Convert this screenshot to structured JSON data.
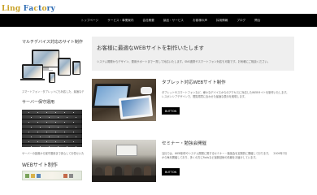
{
  "logo": {
    "chars": [
      {
        "ch": "L",
        "color": "#c9a227"
      },
      {
        "ch": "i",
        "color": "#c9a227"
      },
      {
        "ch": "n",
        "color": "#c9a227"
      },
      {
        "ch": "g",
        "color": "#c9a227"
      },
      {
        "ch": " ",
        "color": "#ffffff"
      },
      {
        "ch": "F",
        "color": "#2d6bb3"
      },
      {
        "ch": "a",
        "color": "#2d6bb3"
      },
      {
        "ch": "c",
        "color": "#c9a227"
      },
      {
        "ch": "t",
        "color": "#2d6bb3"
      },
      {
        "ch": "o",
        "color": "#c9a227"
      },
      {
        "ch": "r",
        "color": "#2d6bb3"
      },
      {
        "ch": "y",
        "color": "#2d6bb3"
      }
    ]
  },
  "nav": {
    "items": [
      "トップページ",
      "サービス・事業案内",
      "会社概要",
      "製品・サービス",
      "お客様の声",
      "採用情報",
      "ブログ",
      "問合"
    ]
  },
  "sidebar": {
    "section1_title": "マルチデバイス対応のサイト制作",
    "section1_text": "スマートフォン・タブレットにも対応した、最適なデザインです",
    "section2_title": "サーバー保守運用",
    "section2_text": "サーバーの設置から保守運用まで安心してお任せいただけます",
    "section3_title": "WEBサイト制作"
  },
  "hero": {
    "title": "お客様に最適なWEBサイトを制作いたします",
    "text": "システム開発からデザイン、運用サポートまで一貫して対応いたします。SNS連携やスマートフォン対応も可能です。お気軽にご相談ください。"
  },
  "articles": [
    {
      "title": "タブレット対応WEBサイト制作",
      "text_lines": [
        "タブレットやスマートフォンなど、様々なデバイスからのアクセスに対応したWEBサイトを制作いたします。",
        "レスポンシブデザインで、閲覧環境に合わせた最適な表示を実現します。"
      ],
      "button": "BUTTON"
    },
    {
      "title": "セミナー・勉強会開催",
      "text_lines": [
        "当社では、WEB制作やシステム開発に関するセミナー・勉強会を定期的に開催しております。　2009年7月",
        "から毎月開催しており、多くの方にRailsなど最新技術の情報をお届けしています。"
      ],
      "button": "BUTTON"
    }
  ]
}
